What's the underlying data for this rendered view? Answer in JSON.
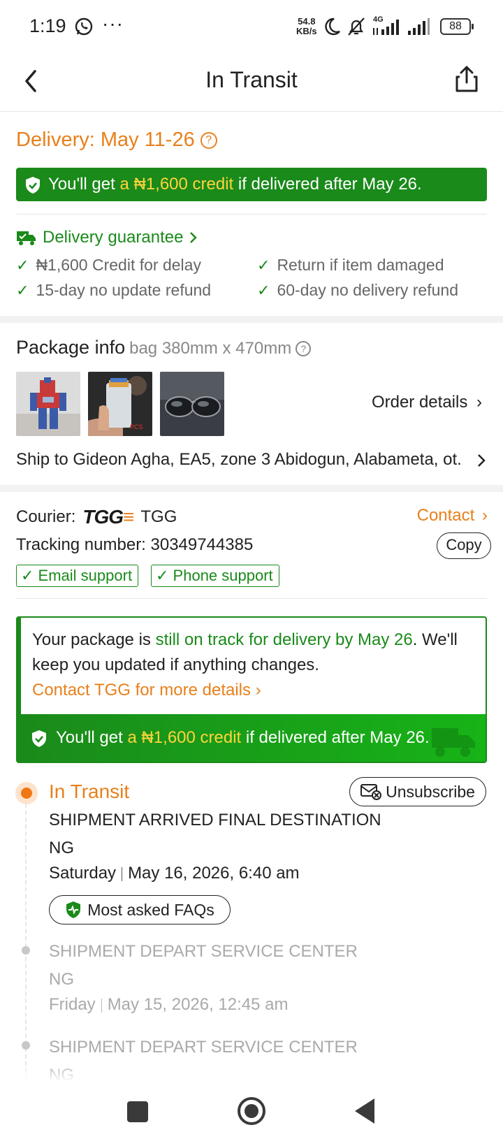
{
  "status_bar": {
    "time": "1:19",
    "more": "···",
    "speed_value": "54.8",
    "speed_unit": "KB/s",
    "network": "4G",
    "battery": "88"
  },
  "nav": {
    "title": "In Transit"
  },
  "delivery": {
    "title": "Delivery: May 11-26",
    "help": "?",
    "credit_prefix": "You'll get ",
    "credit_amount": "a ₦1,600 credit",
    "credit_suffix": " if delivered after May 26."
  },
  "guarantee": {
    "title": "Delivery guarantee",
    "items": [
      "₦1,600 Credit for delay",
      "Return if item damaged",
      "15-day no update refund",
      "60-day no delivery refund"
    ]
  },
  "package": {
    "title": "Package info",
    "subtitle": "bag 380mm x 470mm",
    "help": "?",
    "order_details": "Order details",
    "ship_to": "Ship to Gideon Agha, EA5, zone 3 Abidogun, Alabameta, ot..."
  },
  "courier": {
    "label": "Courier:",
    "logo_text": "TGG",
    "name": "TGG",
    "contact": "Contact",
    "tracking": "Tracking number: 30349744385",
    "copy": "Copy",
    "tags": [
      "Email support",
      "Phone support"
    ]
  },
  "track_box": {
    "text_prefix": "Your package is ",
    "text_highlight": "still on track for delivery by May 26",
    "text_suffix": ". We'll keep you updated if anything changes.",
    "contact": "Contact TGG for more details",
    "credit_prefix": "You'll get ",
    "credit_amount": "a ₦1,600 credit",
    "credit_suffix": " if delivered after May 26."
  },
  "timeline": {
    "status": "In Transit",
    "unsubscribe": "Unsubscribe",
    "faq": "Most asked FAQs",
    "events": [
      {
        "event": "SHIPMENT ARRIVED FINAL DESTINATION",
        "location": "NG",
        "day": "Saturday",
        "datetime": "May 16, 2026, 6:40 am"
      },
      {
        "event": "SHIPMENT DEPART SERVICE CENTER",
        "location": "NG",
        "day": "Friday",
        "datetime": "May 15, 2026, 12:45 am"
      },
      {
        "event": "SHIPMENT DEPART SERVICE CENTER",
        "location": "NG"
      }
    ]
  },
  "colors": {
    "orange": "#e8801c",
    "green": "#1a8a1a",
    "highlight": "#ffd43b"
  }
}
